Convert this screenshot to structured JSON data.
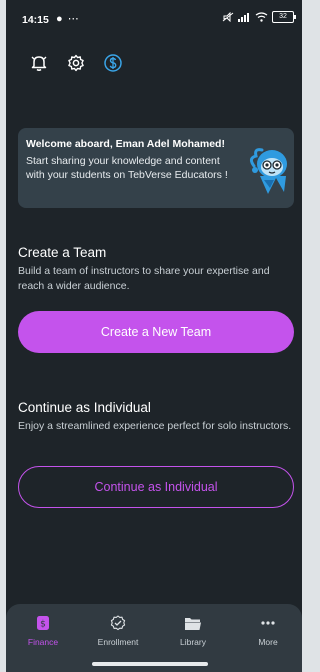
{
  "status_bar": {
    "time": "14:15",
    "left_icons": "● ⋯",
    "battery": "32"
  },
  "top_icons": [
    {
      "name": "notification-bell-icon"
    },
    {
      "name": "settings-gear-icon"
    },
    {
      "name": "dollar-coin-icon"
    }
  ],
  "welcome": {
    "title": "Welcome aboard, Eman Adel Mohamed!",
    "text": "Start sharing your knowledge and content with your students on TebVerse Educators !"
  },
  "team": {
    "title": "Create a Team",
    "desc": "Build a team of instructors to share your expertise and reach a wider audience.",
    "button": "Create a New Team"
  },
  "individual": {
    "title": "Continue as Individual",
    "desc": "Enjoy a streamlined experience perfect for solo instructors.",
    "button": "Continue as Individual"
  },
  "nav": {
    "items": [
      {
        "label": "Finance",
        "icon": "finance-icon",
        "active": true
      },
      {
        "label": "Enrollment",
        "icon": "enrollment-check-icon",
        "active": false
      },
      {
        "label": "Library",
        "icon": "folder-icon",
        "active": false
      },
      {
        "label": "More",
        "icon": "more-dots-icon",
        "active": false
      }
    ]
  },
  "colors": {
    "accent": "#c453ec",
    "background": "#1e2429",
    "card": "#34414a",
    "nav": "#313a41"
  }
}
